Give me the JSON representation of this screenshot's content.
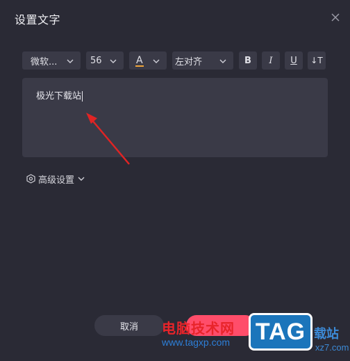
{
  "dialog": {
    "title": "设置文字"
  },
  "toolbar": {
    "font_family": "微软...",
    "font_size": "56",
    "color_label": "A",
    "color_underline": "#f0a53a",
    "alignment": "左对齐",
    "bold_label": "B",
    "italic_label": "I",
    "underline_label": "U",
    "direction_label": "↓T"
  },
  "editor": {
    "text": "极光下载站"
  },
  "advanced": {
    "label": "高级设置"
  },
  "footer": {
    "cancel_label": "取消",
    "confirm_color": "#ff4d6a"
  },
  "watermark": {
    "cn_text": "电脑技术网",
    "url": "www.tagxp.com",
    "logo": "TAG",
    "side_text": "载站",
    "side_url": "xz7.com"
  },
  "colors": {
    "background": "#2a2a35",
    "field": "#3a3a47",
    "accent": "#ff4d6a",
    "annotation_arrow": "#e02424"
  }
}
